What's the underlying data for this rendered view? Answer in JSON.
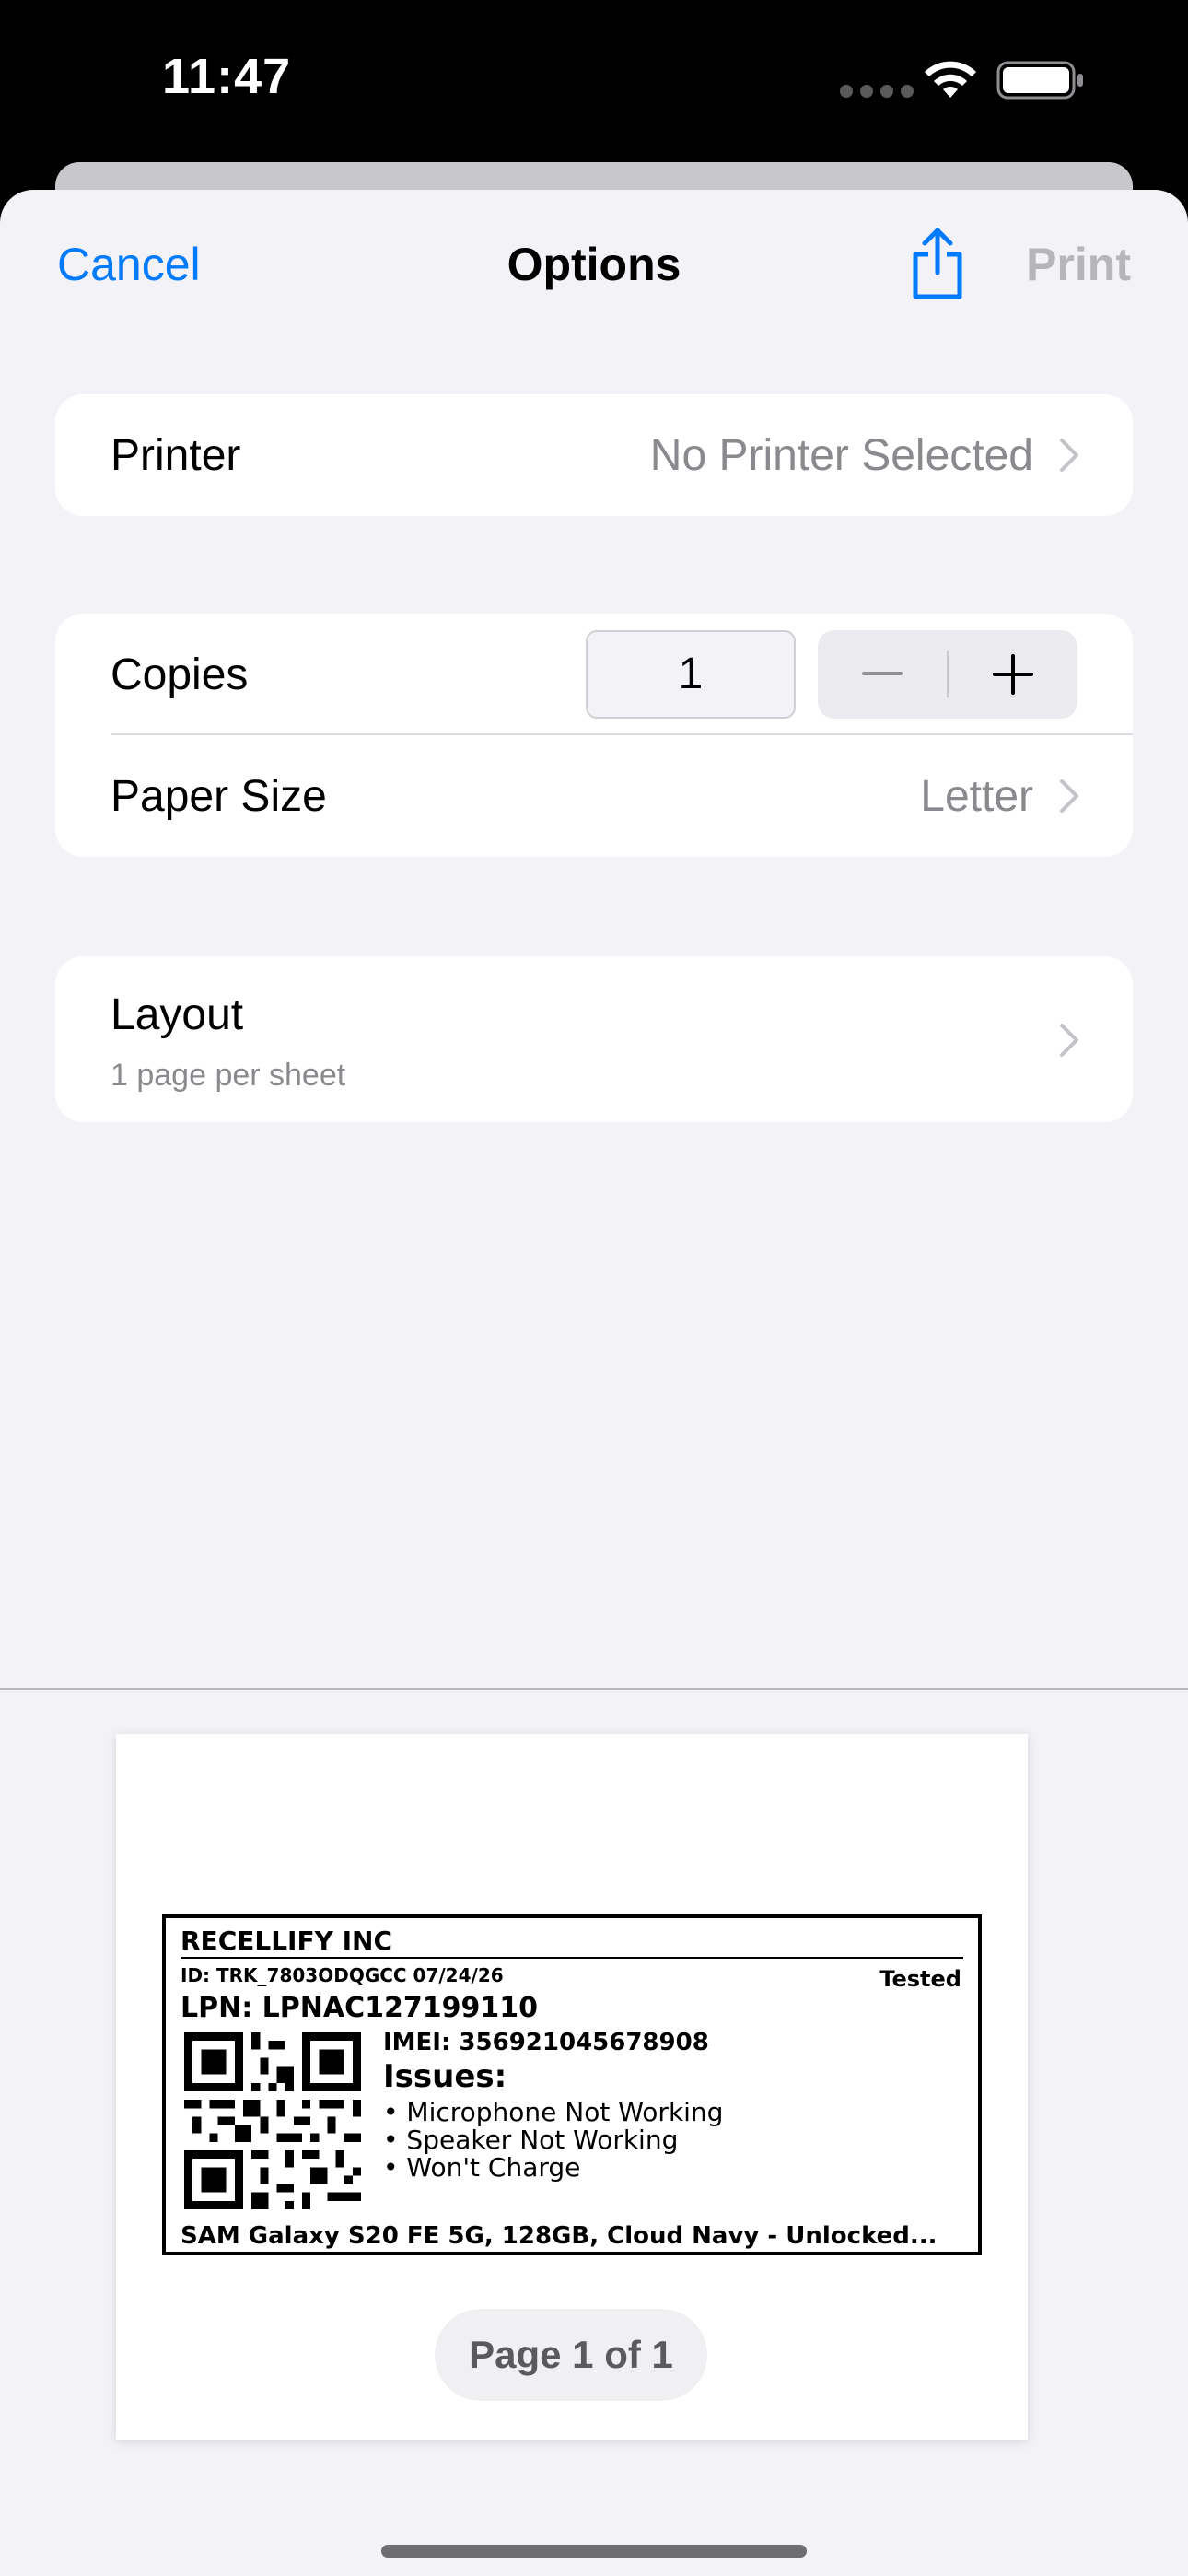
{
  "status_bar": {
    "time": "11:47"
  },
  "nav": {
    "cancel": "Cancel",
    "title": "Options",
    "print": "Print",
    "share_icon": "share-icon"
  },
  "printer_row": {
    "label": "Printer",
    "value": "No Printer Selected"
  },
  "copies_row": {
    "label": "Copies",
    "value": "1"
  },
  "paper_size_row": {
    "label": "Paper Size",
    "value": "Letter"
  },
  "layout_row": {
    "label": "Layout",
    "subtitle": "1 page per sheet"
  },
  "preview": {
    "label": {
      "company": "RECELLIFY INC",
      "id_line": "ID: TRK_7803ODQGCC  07/24/26",
      "status": "Tested",
      "lpn": "LPN: LPNAC127199110",
      "imei": "IMEI: 356921045678908",
      "issues_title": "Issues:",
      "issues": [
        "• Microphone Not Working",
        "• Speaker Not Working",
        "• Won't Charge"
      ],
      "model": "SAM Galaxy S20 FE 5G, 128GB, Cloud Navy - Unlocked..."
    },
    "page_indicator": "Page 1 of 1"
  },
  "colors": {
    "accent": "#007aff",
    "disabled": "#b5b5ba",
    "background": "#f2f2f7"
  }
}
